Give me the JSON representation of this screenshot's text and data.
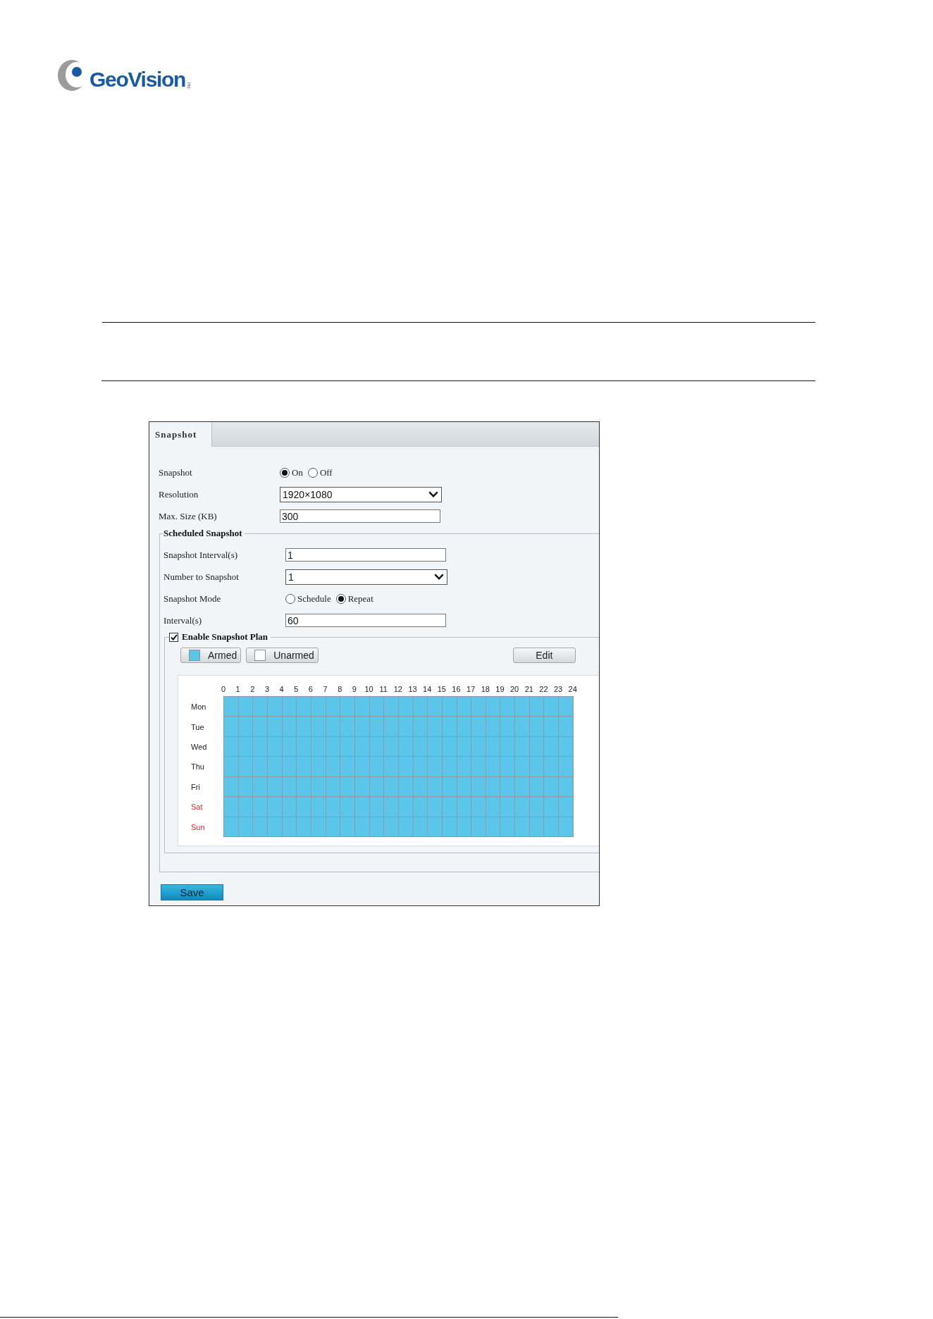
{
  "logo": {
    "wordmark": "GeoVision",
    "suffix": "inc"
  },
  "panel": {
    "tabs": [
      {
        "label": "Snapshot",
        "selected": true
      }
    ],
    "fields": [
      {
        "kind": "radio",
        "label": "Snapshot",
        "options": [
          {
            "label": "On",
            "selected": true
          },
          {
            "label": "Off",
            "selected": false
          }
        ]
      },
      {
        "kind": "select",
        "label": "Resolution",
        "value": "1920×1080"
      },
      {
        "kind": "text",
        "label": "Max. Size (KB)",
        "value": "300"
      }
    ],
    "scheduled": {
      "legend": "Scheduled Snapshot",
      "fields": [
        {
          "kind": "text",
          "label": "Snapshot Interval(s)",
          "value": "1"
        },
        {
          "kind": "select",
          "label": "Number to Snapshot",
          "value": "1"
        },
        {
          "kind": "radio",
          "label": "Snapshot Mode",
          "options": [
            {
              "label": "Schedule",
              "selected": false
            },
            {
              "label": "Repeat",
              "selected": true
            }
          ]
        },
        {
          "kind": "text",
          "label": "Interval(s)",
          "value": "60"
        }
      ],
      "plan": {
        "legend": "Enable Snapshot Plan",
        "checked": true,
        "legend_buttons": [
          {
            "label": "Armed",
            "color": "#5bc5ea"
          },
          {
            "label": "Unarmed",
            "color": "#ffffff"
          }
        ],
        "edit_button": "Edit",
        "hours": [
          "0",
          "1",
          "2",
          "3",
          "4",
          "5",
          "6",
          "7",
          "8",
          "9",
          "10",
          "11",
          "12",
          "13",
          "14",
          "15",
          "16",
          "17",
          "18",
          "19",
          "20",
          "21",
          "22",
          "23",
          "24"
        ],
        "days": [
          {
            "label": "Mon",
            "weekend": false,
            "armed": [
              true,
              true,
              true,
              true,
              true,
              true,
              true,
              true,
              true,
              true,
              true,
              true,
              true,
              true,
              true,
              true,
              true,
              true,
              true,
              true,
              true,
              true,
              true,
              true
            ]
          },
          {
            "label": "Tue",
            "weekend": false,
            "armed": [
              true,
              true,
              true,
              true,
              true,
              true,
              true,
              true,
              true,
              true,
              true,
              true,
              true,
              true,
              true,
              true,
              true,
              true,
              true,
              true,
              true,
              true,
              true,
              true
            ]
          },
          {
            "label": "Wed",
            "weekend": false,
            "armed": [
              true,
              true,
              true,
              true,
              true,
              true,
              true,
              true,
              true,
              true,
              true,
              true,
              true,
              true,
              true,
              true,
              true,
              true,
              true,
              true,
              true,
              true,
              true,
              true
            ]
          },
          {
            "label": "Thu",
            "weekend": false,
            "armed": [
              true,
              true,
              true,
              true,
              true,
              true,
              true,
              true,
              true,
              true,
              true,
              true,
              true,
              true,
              true,
              true,
              true,
              true,
              true,
              true,
              true,
              true,
              true,
              true
            ]
          },
          {
            "label": "Fri",
            "weekend": false,
            "armed": [
              true,
              true,
              true,
              true,
              true,
              true,
              true,
              true,
              true,
              true,
              true,
              true,
              true,
              true,
              true,
              true,
              true,
              true,
              true,
              true,
              true,
              true,
              true,
              true
            ]
          },
          {
            "label": "Sat",
            "weekend": true,
            "armed": [
              true,
              true,
              true,
              true,
              true,
              true,
              true,
              true,
              true,
              true,
              true,
              true,
              true,
              true,
              true,
              true,
              true,
              true,
              true,
              true,
              true,
              true,
              true,
              true
            ]
          },
          {
            "label": "Sun",
            "weekend": true,
            "armed": [
              true,
              true,
              true,
              true,
              true,
              true,
              true,
              true,
              true,
              true,
              true,
              true,
              true,
              true,
              true,
              true,
              true,
              true,
              true,
              true,
              true,
              true,
              true,
              true
            ]
          }
        ]
      }
    },
    "save_button": "Save"
  }
}
